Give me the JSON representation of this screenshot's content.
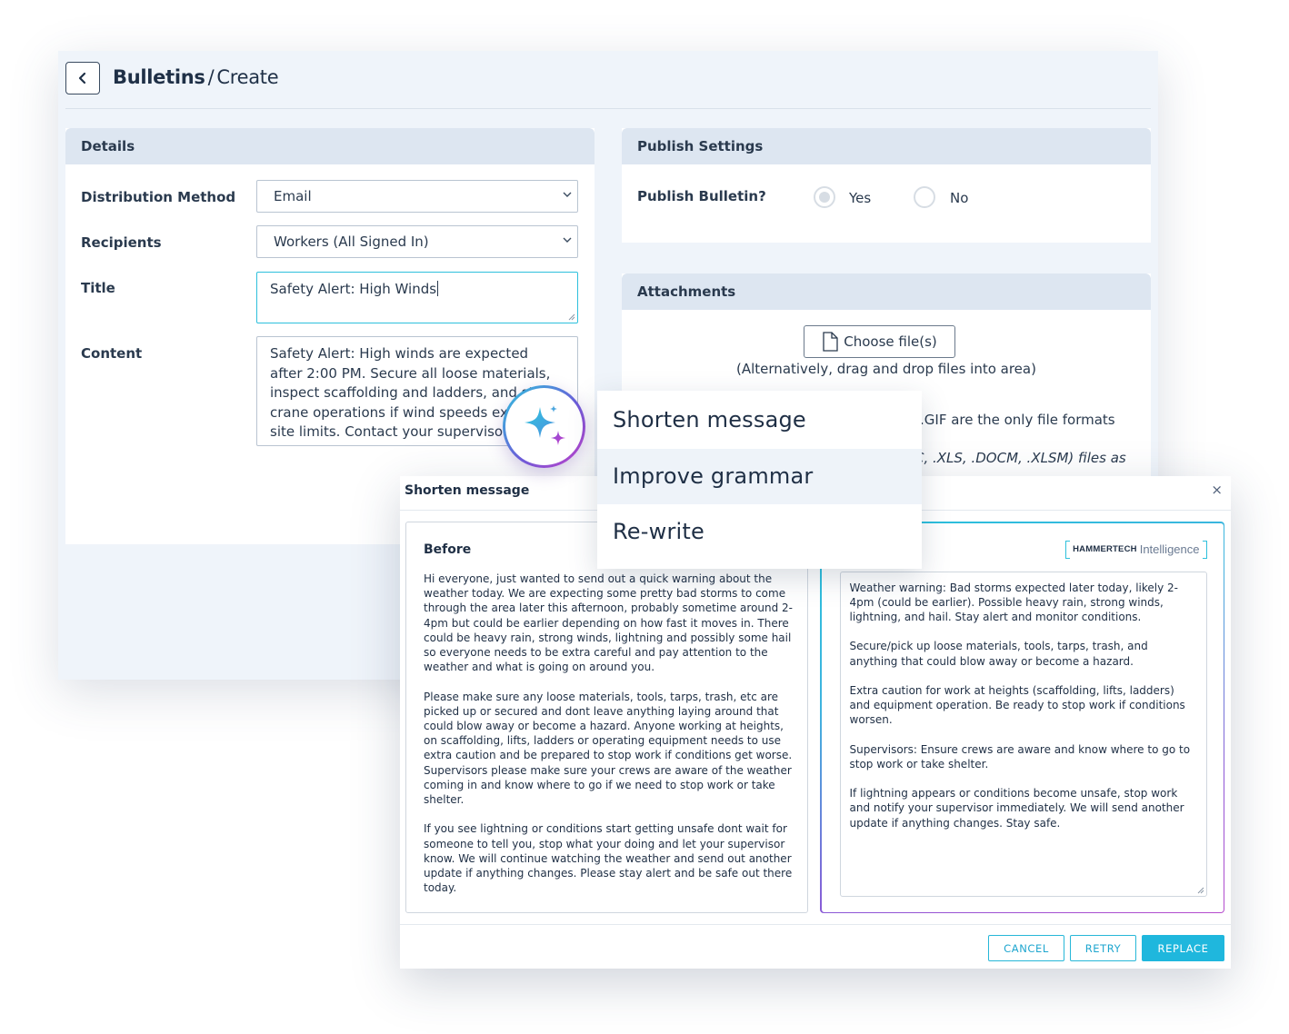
{
  "page": {
    "breadcrumb_main": "Bulletins",
    "breadcrumb_separator": "/",
    "breadcrumb_current": "Create"
  },
  "details": {
    "heading": "Details",
    "distribution_label": "Distribution Method",
    "distribution_value": "Email",
    "recipients_label": "Recipients",
    "recipients_value": "Workers (All Signed In)",
    "title_label": "Title",
    "title_value": "Safety Alert: High Winds",
    "content_label": "Content",
    "content_value": "Safety Alert: High winds are expected after 2:00 PM. Secure all loose materials, inspect scaffolding and ladders, and stop crane operations if wind speeds exceed site limits. Contact your supervisor with any concerns. Stay safe."
  },
  "publish": {
    "heading": "Publish Settings",
    "question": "Publish Bulletin?",
    "yes_label": "Yes",
    "no_label": "No",
    "selected": "Yes"
  },
  "attachments": {
    "heading": "Attachments",
    "choose_label": "Choose file(s)",
    "drag_hint": "(Alternatively, drag and drop files into area)",
    "format_note_1": ".GIF are the only file formats",
    "format_note_2": "C, .XLS, .DOCM, .XLSM) files as"
  },
  "ai_menu": {
    "items": [
      "Shorten message",
      "Improve grammar",
      "Re-write"
    ],
    "active_index": 1
  },
  "modal": {
    "title": "Shorten message",
    "close_glyph": "×",
    "before_heading": "Before",
    "before_paragraphs": [
      "Hi everyone, just wanted to send out a quick warning about the weather today. We are expecting some pretty bad storms to come through the area later this afternoon, probably sometime around 2-4pm but could be earlier depending on how fast it moves in. There could be heavy rain, strong winds, lightning and possibly some hail so everyone needs to be extra careful and pay attention to the weather and what is going on around you.",
      "Please make sure any loose materials, tools, tarps, trash, etc are picked up or secured and dont leave anything laying around that could blow away or become a hazard. Anyone working at heights, on scaffolding, lifts, ladders or operating equipment needs to use extra caution and be prepared to stop work if conditions get worse. Supervisors please make sure your crews are aware of the weather coming in and know where to go if we need to stop work or take shelter.",
      "If you see lightning or conditions start getting unsafe dont wait for someone to tell you, stop what your doing and let your supervisor know. We will continue watching the weather and send out another update if anything changes. Please stay alert and be safe out there today."
    ],
    "brand_name": "HAMMERTECH",
    "brand_suffix": "Intelligence",
    "after_paragraphs": [
      "Weather warning: Bad storms expected later today, likely 2-4pm (could be earlier). Possible heavy rain, strong winds, lightning, and hail. Stay alert and monitor conditions.",
      "Secure/pick up loose materials, tools, tarps, trash, and anything that could blow away or become a hazard.",
      "Extra caution for work at heights (scaffolding, lifts, ladders) and equipment operation. Be ready to stop work if conditions worsen.",
      "Supervisors: Ensure crews are aware and know where to go to stop work or take shelter.",
      "If lightning appears or conditions become unsafe, stop work and notify your supervisor immediately. We will send another update if anything changes. Stay safe."
    ],
    "cancel_label": "CANCEL",
    "retry_label": "RETRY",
    "replace_label": "REPLACE"
  },
  "colors": {
    "accent": "#1fb7dd",
    "gradient_start": "#2ec6de",
    "gradient_end": "#c43fc9",
    "panel_header": "#dde6f1"
  },
  "icons": {
    "back": "chevron-left-icon",
    "dropdown": "chevron-down-icon",
    "file": "file-icon",
    "ai": "sparkle-icon",
    "close": "close-icon"
  }
}
